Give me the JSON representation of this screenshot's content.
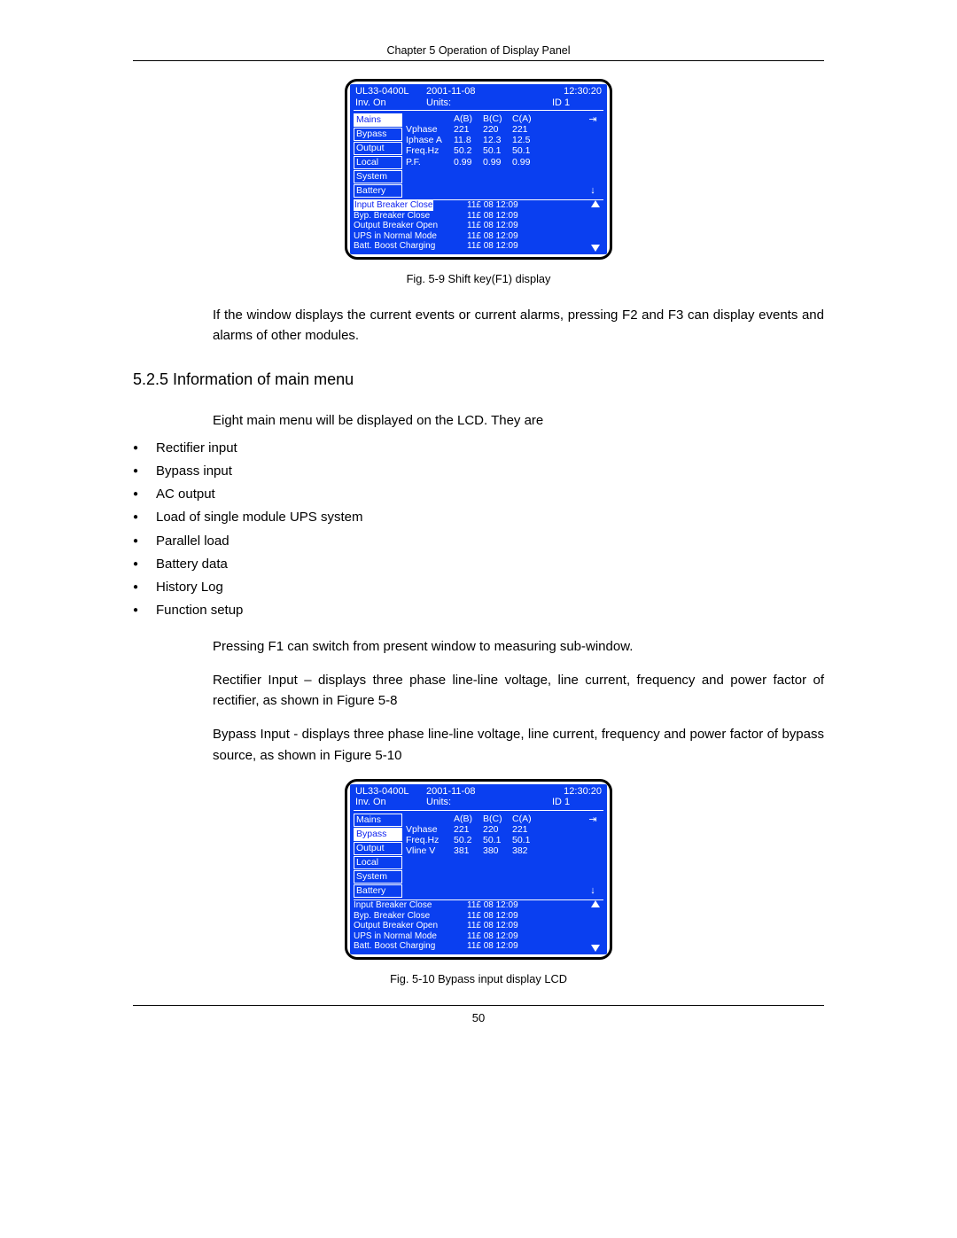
{
  "chapter_header": "Chapter 5  Operation of Display Panel",
  "page_number": "50",
  "lcd1": {
    "model": "UL33-0400L",
    "date": "2001-11-08",
    "time": "12:30:20",
    "status": "Inv. On",
    "units_label": "Units:",
    "id": "ID 1",
    "menu": [
      "Mains",
      "Bypass",
      "Output",
      "Local",
      "System",
      "Battery"
    ],
    "selected_index": 0,
    "col_headers": [
      "",
      "A(B)",
      "B(C)",
      "C(A)"
    ],
    "rows": [
      {
        "label": "Vphase",
        "a": "221",
        "b": "220",
        "c": "221"
      },
      {
        "label": "Iphase A",
        "a": "11.8",
        "b": "12.3",
        "c": "12.5"
      },
      {
        "label": "Freq.Hz",
        "a": "50.2",
        "b": "50.1",
        "c": "50.1"
      },
      {
        "label": "P.F.",
        "a": "0.99",
        "b": "0.99",
        "c": "0.99"
      }
    ],
    "events": [
      {
        "label": "Input Breaker Close",
        "boxed": true,
        "ts": "11£ 08  12:09"
      },
      {
        "label": "Byp. Breaker Close",
        "boxed": false,
        "ts": "11£ 08  12:09"
      },
      {
        "label": "Output Breaker Open",
        "boxed": false,
        "ts": "11£ 08  12:09"
      },
      {
        "label": "UPS in Normal Mode",
        "boxed": false,
        "ts": "11£ 08  12:09"
      },
      {
        "label": "Batt. Boost Charging",
        "boxed": false,
        "ts": "11£ 08  12:09"
      }
    ]
  },
  "fig1_caption": "Fig. 5-9  Shift key(F1) display",
  "para1": "If the window displays the current events or current alarms, pressing F2 and F3 can display events and alarms of other modules.",
  "section_heading": "5.2.5  Information of main menu",
  "para2": "Eight main menu will be displayed on the LCD. They are",
  "bullets": [
    "Rectifier input",
    "Bypass input",
    "AC output",
    "Load of single module UPS system",
    "Parallel load",
    "Battery data",
    "History Log",
    "Function setup"
  ],
  "para3": "Pressing F1 can switch from present window to measuring sub-window.",
  "para4": "Rectifier Input – displays three phase line-line voltage, line current, frequency and power factor of rectifier, as shown in Figure 5-8",
  "para5": "Bypass Input - displays three phase line-line voltage, line current, frequency and power factor of bypass source, as shown in Figure 5-10",
  "lcd2": {
    "model": "UL33-0400L",
    "date": "2001-11-08",
    "time": "12:30:20",
    "status": "Inv. On",
    "units_label": "Units:",
    "id": "ID 1",
    "menu": [
      "Mains",
      "Bypass",
      "Output",
      "Local",
      "System",
      "Battery"
    ],
    "selected_index": 1,
    "col_headers": [
      "",
      "A(B)",
      "B(C)",
      "C(A)"
    ],
    "rows": [
      {
        "label": "Vphase",
        "a": "221",
        "b": "220",
        "c": "221"
      },
      {
        "label": "Freq.Hz",
        "a": "50.2",
        "b": "50.1",
        "c": "50.1"
      },
      {
        "label": "Vline V",
        "a": "381",
        "b": "380",
        "c": "382"
      }
    ],
    "events": [
      {
        "label": "Input Breaker Close",
        "boxed": false,
        "ts": "11£ 08  12:09"
      },
      {
        "label": "Byp. Breaker Close",
        "boxed": false,
        "ts": "11£ 08  12:09"
      },
      {
        "label": "Output Breaker Open",
        "boxed": false,
        "ts": "11£ 08  12:09"
      },
      {
        "label": "UPS in Normal Mode",
        "boxed": false,
        "ts": "11£ 08  12:09"
      },
      {
        "label": "Batt. Boost Charging",
        "boxed": false,
        "ts": "11£ 08  12:09"
      }
    ]
  },
  "fig2_caption": "Fig. 5-10  Bypass input display LCD"
}
